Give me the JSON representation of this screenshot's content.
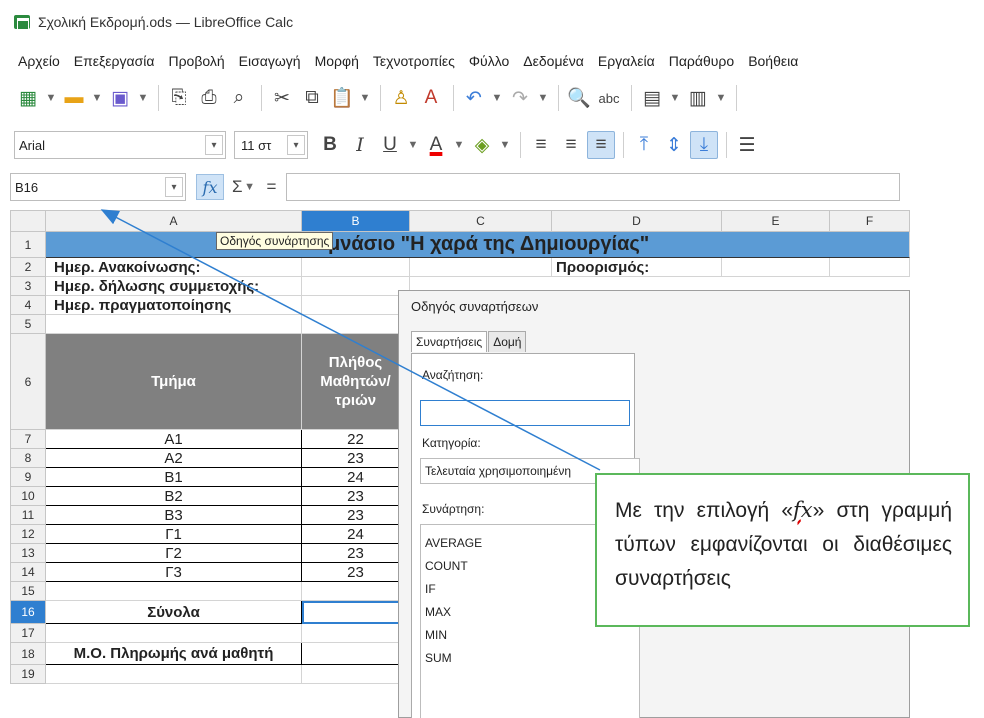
{
  "window": {
    "title": "Σχολική Εκδρομή.ods — LibreOffice Calc"
  },
  "menu": [
    "Αρχείο",
    "Επεξεργασία",
    "Προβολή",
    "Εισαγωγή",
    "Μορφή",
    "Τεχνοτροπίες",
    "Φύλλο",
    "Δεδομένα",
    "Εργαλεία",
    "Παράθυρο",
    "Βοήθεια"
  ],
  "format": {
    "font": "Arial",
    "size": "11 στ"
  },
  "formula_bar": {
    "name_box": "B16",
    "fx": "fx",
    "sum": "Σ",
    "equals": "="
  },
  "columns": [
    "A",
    "B",
    "C",
    "D",
    "E",
    "F"
  ],
  "rows": [
    "1",
    "2",
    "3",
    "4",
    "5",
    "6",
    "7",
    "8",
    "9",
    "10",
    "11",
    "12",
    "13",
    "14",
    "15",
    "16",
    "17",
    "18",
    "19"
  ],
  "sheet": {
    "title_row": "μνάσιο \"Η χαρά της Δημιουργίας\"",
    "a2": "Ημερ. Ανακοίνωσης:",
    "a3": "Ημερ. δήλωσης συμμετοχής:",
    "a4": "Ημερ. πραγματοποίησης",
    "d2": "Προορισμός:",
    "a6": "Τμήμα",
    "b6_lines": [
      "Πλήθος",
      "Μαθητών/",
      "τριών"
    ],
    "classes": [
      "Α1",
      "Α2",
      "Β1",
      "Β2",
      "Β3",
      "Γ1",
      "Γ2",
      "Γ3"
    ],
    "students": [
      "22",
      "23",
      "24",
      "23",
      "23",
      "24",
      "23",
      "23"
    ],
    "a16": "Σύνολα",
    "a18": "Μ.Ο. Πληρωμής ανά μαθητή"
  },
  "tooltip": "Οδηγός συνάρτησης",
  "dialog": {
    "title": "Οδηγός συναρτήσεων",
    "tabs": [
      "Συναρτήσεις",
      "Δομή"
    ],
    "search_label": "Αναζήτηση:",
    "category_label": "Κατηγορία:",
    "category_value": "Τελευταία χρησιμοποιημένη",
    "function_label": "Συνάρτηση:",
    "functions": [
      "AVERAGE",
      "COUNT",
      "IF",
      "MAX",
      "MIN",
      "SUM"
    ]
  },
  "callout": {
    "before": "Με την επιλογή «",
    "fx_f": "f",
    "fx_x": "x",
    "after": "» στη γραμμή τύπων εμφανίζονται οι διαθέσιμες συναρτήσεις"
  },
  "colors": {
    "selection": "#2f7fd0",
    "title_fill": "#5b9bd5",
    "callout_border": "#5bb85b"
  }
}
